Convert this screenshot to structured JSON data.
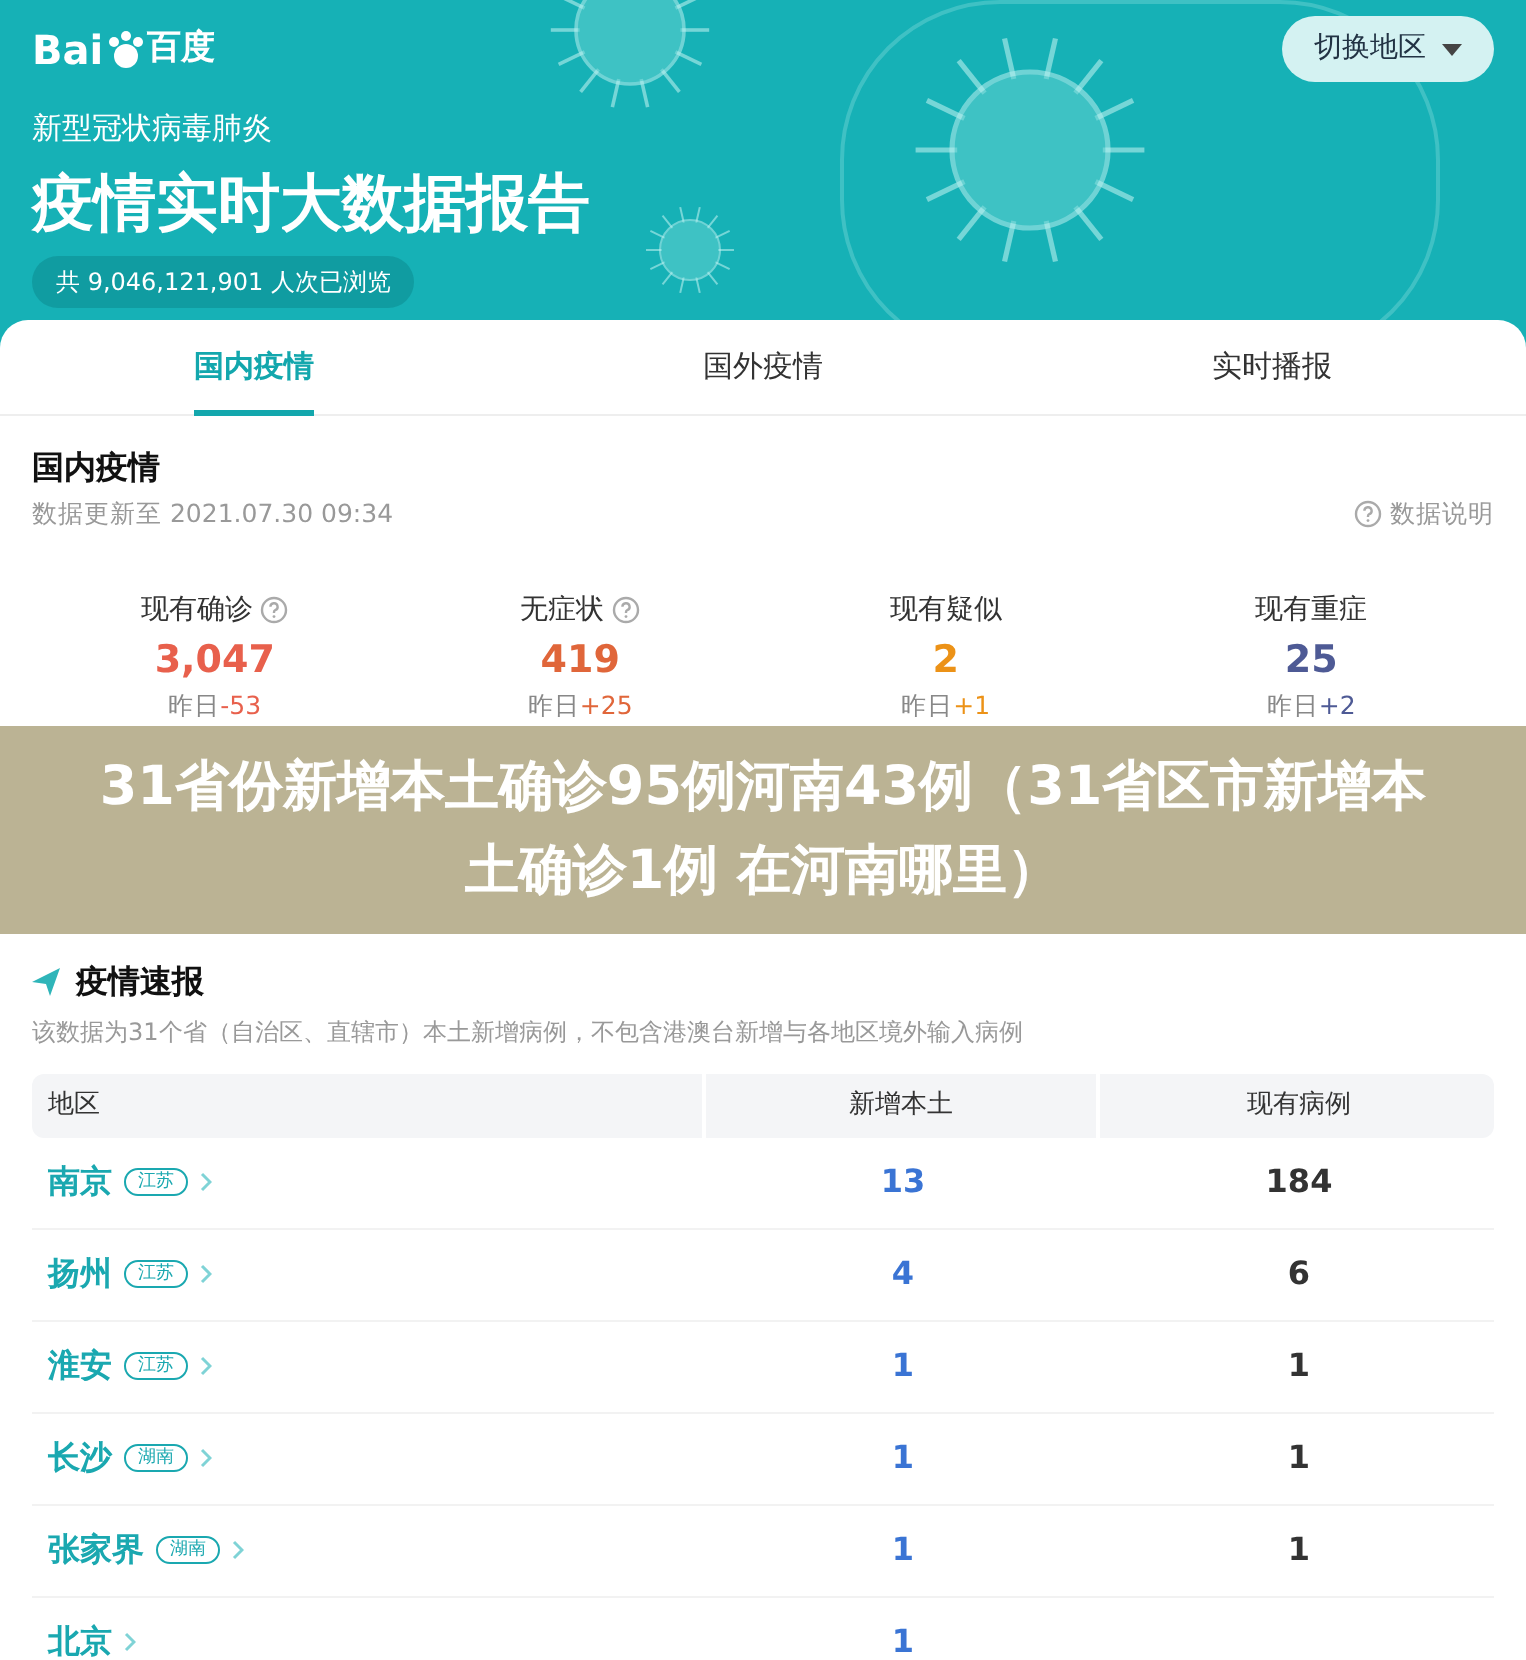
{
  "header": {
    "logo": "Bai",
    "logo_tail": "百度",
    "subtitle": "新型冠状病毒肺炎",
    "title": "疫情实时大数据报告",
    "views": "共 9,046,121,901 人次已浏览",
    "region_button": "切换地区"
  },
  "tabs": [
    {
      "label": "国内疫情",
      "selected": true
    },
    {
      "label": "国外疫情",
      "selected": false
    },
    {
      "label": "实时播报",
      "selected": false
    }
  ],
  "domestic": {
    "title": "国内疫情",
    "updated": "数据更新至 2021.07.30 09:34",
    "help": "数据说明",
    "stats": [
      {
        "label": "现有确诊",
        "help_icon": true,
        "value": "3,047",
        "delta_prefix": "昨日",
        "delta": "-53",
        "color": "#e8604c"
      },
      {
        "label": "无症状",
        "help_icon": true,
        "value": "419",
        "delta_prefix": "昨日",
        "delta": "+25",
        "color": "#e0663a"
      },
      {
        "label": "现有疑似",
        "help_icon": false,
        "value": "2",
        "delta_prefix": "昨日",
        "delta": "+1",
        "color": "#ec9217"
      },
      {
        "label": "现有重症",
        "help_icon": false,
        "value": "25",
        "delta_prefix": "昨日",
        "delta": "+2",
        "color": "#4e5a95"
      }
    ]
  },
  "headline": "31省份新增本土确诊95例河南43例（31省区市新增本土确诊1例 在河南哪里）",
  "bulletin": {
    "title": "疫情速报",
    "note": "该数据为31个省（自治区、直辖市）本土新增病例，不包含港澳台新增与各地区境外输入病例",
    "columns": [
      "地区",
      "新增本土",
      "现有病例"
    ],
    "rows": [
      {
        "city": "南京",
        "province": "江苏",
        "new": "13",
        "existing": "184"
      },
      {
        "city": "扬州",
        "province": "江苏",
        "new": "4",
        "existing": "6"
      },
      {
        "city": "淮安",
        "province": "江苏",
        "new": "1",
        "existing": "1"
      },
      {
        "city": "长沙",
        "province": "湖南",
        "new": "1",
        "existing": "1"
      },
      {
        "city": "张家界",
        "province": "湖南",
        "new": "1",
        "existing": "1"
      },
      {
        "city": "北京",
        "new": "1"
      }
    ]
  }
}
